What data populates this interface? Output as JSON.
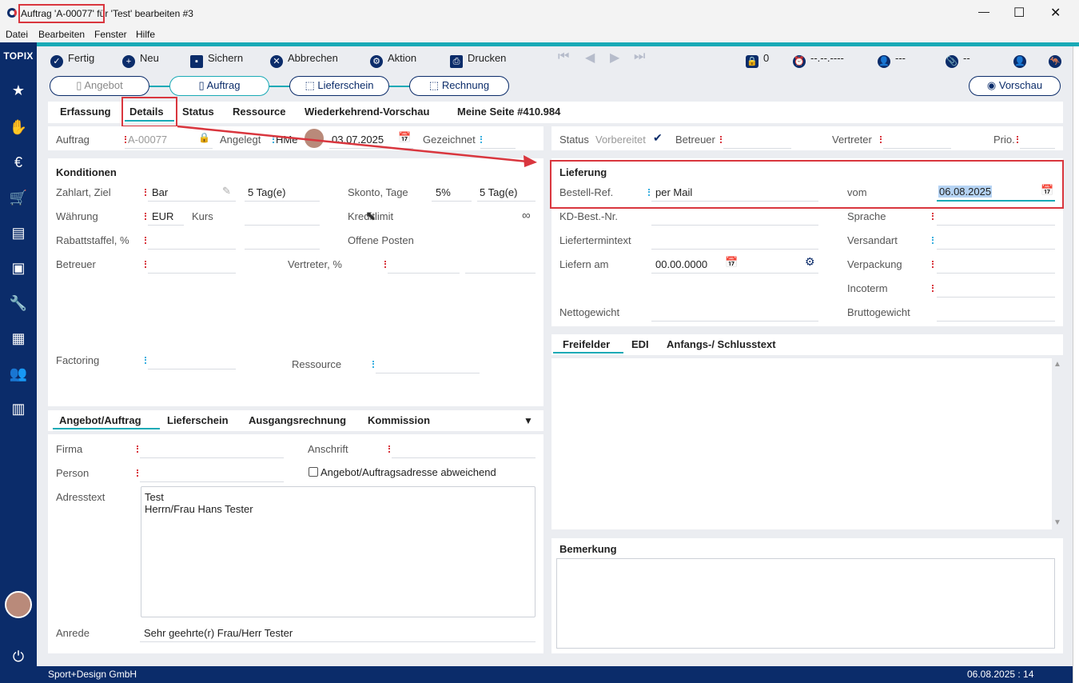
{
  "window": {
    "title": "Auftrag 'A-00077' für 'Test' bearbeiten #3",
    "min": "—",
    "max": "☐",
    "close": "✕"
  },
  "menu": [
    "Datei",
    "Bearbeiten",
    "Fenster",
    "Hilfe"
  ],
  "brand": "TOPIX",
  "toolbar": {
    "fertig": "Fertig",
    "neu": "Neu",
    "sichern": "Sichern",
    "abbrechen": "Abbrechen",
    "aktion": "Aktion",
    "drucken": "Drucken",
    "lock_count": "0",
    "datetime": "--.--.----",
    "user": "---",
    "attach": "--"
  },
  "workflow": {
    "angebot": "Angebot",
    "auftrag": "Auftrag",
    "lieferschein": "Lieferschein",
    "rechnung": "Rechnung",
    "vorschau": "Vorschau"
  },
  "tabs": [
    "Erfassung",
    "Details",
    "Status",
    "Ressource",
    "Wiederkehrend-Vorschau",
    "Meine Seite #410.984"
  ],
  "header": {
    "auftrag_label": "Auftrag",
    "auftrag_value": "A-00077",
    "angelegt_label": "Angelegt",
    "angelegt_user": "HMe",
    "angelegt_date": "03.07.2025",
    "gezeichnet_label": "Gezeichnet"
  },
  "status_row": {
    "status_label": "Status",
    "status_value": "Vorbereitet",
    "betreuer_label": "Betreuer",
    "vertreter_label": "Vertreter",
    "prio_label": "Prio."
  },
  "konditionen": {
    "title": "Konditionen",
    "zahlart_label": "Zahlart, Ziel",
    "zahlart_value": "Bar",
    "ziel_value": "5 Tag(e)",
    "skonto_label": "Skonto, Tage",
    "skonto_pct": "5%",
    "skonto_days": "5 Tag(e)",
    "waehrung_label": "Währung",
    "waehrung_value": "EUR",
    "kurs_label": "Kurs",
    "kreditlimit_label": "Kreditlimit",
    "kreditlimit_value": "∞",
    "rabatt_label": "Rabattstaffel, %",
    "offene_label": "Offene Posten",
    "betreuer_label": "Betreuer",
    "vertreter_label": "Vertreter, %",
    "factoring_label": "Factoring",
    "ressource_label": "Ressource"
  },
  "lieferung": {
    "title": "Lieferung",
    "bestell_label": "Bestell-Ref.",
    "bestell_value": "per Mail",
    "vom_label": "vom",
    "vom_value": "06.08.2025",
    "kd_label": "KD-Best.-Nr.",
    "sprache_label": "Sprache",
    "liefertermintext_label": "Liefertermintext",
    "versandart_label": "Versandart",
    "liefern_label": "Liefern am",
    "liefern_value": "00.00.0000",
    "verpackung_label": "Verpackung",
    "incoterm_label": "Incoterm",
    "netto_label": "Nettogewicht",
    "brutto_label": "Bruttogewicht"
  },
  "right_tabs": [
    "Freifelder",
    "EDI",
    "Anfangs-/ Schlusstext"
  ],
  "bemerkung": {
    "title": "Bemerkung"
  },
  "address_tabs": [
    "Angebot/Auftrag",
    "Lieferschein",
    "Ausgangsrechnung",
    "Kommission"
  ],
  "address": {
    "firma_label": "Firma",
    "anschrift_label": "Anschrift",
    "person_label": "Person",
    "abweichend_label": "Angebot/Auftragsadresse abweichend",
    "adresstext_label": "Adresstext",
    "adresstext_line1": "Test",
    "adresstext_line2": "Herrn/Frau Hans Tester",
    "anrede_label": "Anrede",
    "anrede_value": "Sehr geehrte(r) Frau/Herr Tester"
  },
  "statusbar": {
    "company": "Sport+Design GmbH",
    "datetime": "06.08.2025 : 14"
  },
  "colors": {
    "navy": "#0b2c6a",
    "accent": "#19aab6",
    "required": "#d9363e",
    "highlight": "#d9363e"
  }
}
